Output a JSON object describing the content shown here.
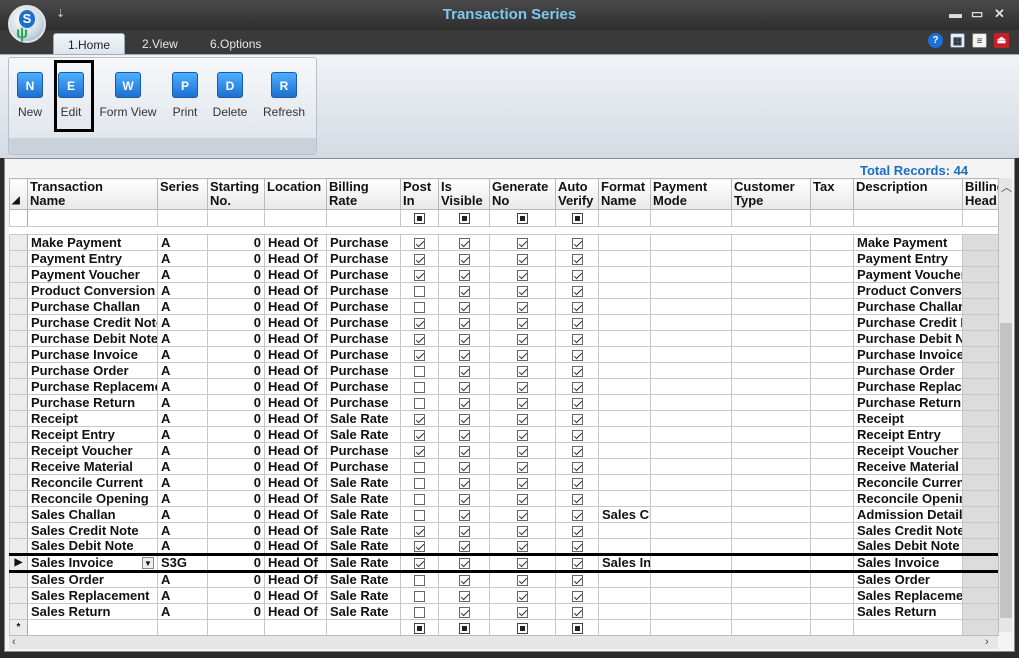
{
  "window": {
    "title": "Transaction Series",
    "qa_glyph": "⇣",
    "minimize": "▬",
    "restore": "▭",
    "close": "✕"
  },
  "tabs": [
    {
      "label": "1.Home"
    },
    {
      "label": "2.View"
    },
    {
      "label": "6.Options"
    }
  ],
  "header_icons": [
    "help-icon",
    "calculator-icon",
    "notes-icon",
    "exit-icon"
  ],
  "ribbon": {
    "buttons": [
      {
        "label": "New",
        "glyph": "N"
      },
      {
        "label": "Edit",
        "glyph": "E"
      },
      {
        "label": "Form View",
        "glyph": "W"
      },
      {
        "label": "Print",
        "glyph": "P"
      },
      {
        "label": "Delete",
        "glyph": "D"
      },
      {
        "label": "Refresh",
        "glyph": "R"
      }
    ]
  },
  "grid": {
    "total_records": "Total Records: 44",
    "columns": [
      "Transaction\nName",
      "Series",
      "Starting\nNo.",
      "Location",
      "Billing\nRate",
      "Post\nIn",
      "Is\nVisible",
      "Generate\nNo",
      "Auto\nVerify",
      "Format\nName",
      "Payment\nMode",
      "Customer\nType",
      "Tax",
      "Description",
      "Billing\nHead"
    ],
    "rows": [
      {
        "name": "Make Payment",
        "series": "A",
        "start": "0",
        "location": "Head Of",
        "rate": "Purchase",
        "post": true,
        "visible": true,
        "gen": true,
        "auto": true,
        "format": "",
        "desc": "Make Payment"
      },
      {
        "name": "Payment Entry",
        "series": "A",
        "start": "0",
        "location": "Head Of",
        "rate": "Purchase",
        "post": true,
        "visible": true,
        "gen": true,
        "auto": true,
        "format": "",
        "desc": "Payment Entry"
      },
      {
        "name": "Payment Voucher",
        "series": "A",
        "start": "0",
        "location": "Head Of",
        "rate": "Purchase",
        "post": true,
        "visible": true,
        "gen": true,
        "auto": true,
        "format": "",
        "desc": "Payment Voucher"
      },
      {
        "name": "Product Conversion",
        "series": "A",
        "start": "0",
        "location": "Head Of",
        "rate": "Purchase",
        "post": false,
        "visible": true,
        "gen": true,
        "auto": true,
        "format": "",
        "desc": "Product Conversion"
      },
      {
        "name": "Purchase Challan",
        "series": "A",
        "start": "0",
        "location": "Head Of",
        "rate": "Purchase",
        "post": false,
        "visible": true,
        "gen": true,
        "auto": true,
        "format": "",
        "desc": "Purchase Challan"
      },
      {
        "name": "Purchase Credit Note",
        "series": "A",
        "start": "0",
        "location": "Head Of",
        "rate": "Purchase",
        "post": true,
        "visible": true,
        "gen": true,
        "auto": true,
        "format": "",
        "desc": "Purchase Credit Note"
      },
      {
        "name": "Purchase Debit Note",
        "series": "A",
        "start": "0",
        "location": "Head Of",
        "rate": "Purchase",
        "post": true,
        "visible": true,
        "gen": true,
        "auto": true,
        "format": "",
        "desc": "Purchase Debit Note"
      },
      {
        "name": "Purchase Invoice",
        "series": "A",
        "start": "0",
        "location": "Head Of",
        "rate": "Purchase",
        "post": true,
        "visible": true,
        "gen": true,
        "auto": true,
        "format": "",
        "desc": "Purchase Invoice"
      },
      {
        "name": "Purchase Order",
        "series": "A",
        "start": "0",
        "location": "Head Of",
        "rate": "Purchase",
        "post": false,
        "visible": true,
        "gen": true,
        "auto": true,
        "format": "",
        "desc": "Purchase Order"
      },
      {
        "name": "Purchase Replacement",
        "series": "A",
        "start": "0",
        "location": "Head Of",
        "rate": "Purchase",
        "post": false,
        "visible": true,
        "gen": true,
        "auto": true,
        "format": "",
        "desc": "Purchase Replacement"
      },
      {
        "name": "Purchase Return",
        "series": "A",
        "start": "0",
        "location": "Head Of",
        "rate": "Purchase",
        "post": false,
        "visible": true,
        "gen": true,
        "auto": true,
        "format": "",
        "desc": "Purchase Return"
      },
      {
        "name": "Receipt",
        "series": "A",
        "start": "0",
        "location": "Head Of",
        "rate": "Sale Rate",
        "post": true,
        "visible": true,
        "gen": true,
        "auto": true,
        "format": "",
        "desc": "Receipt"
      },
      {
        "name": "Receipt Entry",
        "series": "A",
        "start": "0",
        "location": "Head Of",
        "rate": "Sale Rate",
        "post": true,
        "visible": true,
        "gen": true,
        "auto": true,
        "format": "",
        "desc": "Receipt Entry"
      },
      {
        "name": "Receipt Voucher",
        "series": "A",
        "start": "0",
        "location": "Head Of",
        "rate": "Purchase",
        "post": true,
        "visible": true,
        "gen": true,
        "auto": true,
        "format": "",
        "desc": "Receipt Voucher"
      },
      {
        "name": "Receive Material",
        "series": "A",
        "start": "0",
        "location": "Head Of",
        "rate": "Purchase",
        "post": false,
        "visible": true,
        "gen": true,
        "auto": true,
        "format": "",
        "desc": "Receive Material"
      },
      {
        "name": "Reconcile Current",
        "series": "A",
        "start": "0",
        "location": "Head Of",
        "rate": "Sale Rate",
        "post": false,
        "visible": true,
        "gen": true,
        "auto": true,
        "format": "",
        "desc": "Reconcile Current"
      },
      {
        "name": "Reconcile Opening",
        "series": "A",
        "start": "0",
        "location": "Head Of",
        "rate": "Sale Rate",
        "post": false,
        "visible": true,
        "gen": true,
        "auto": true,
        "format": "",
        "desc": "Reconcile Opening"
      },
      {
        "name": "Sales Challan",
        "series": "A",
        "start": "0",
        "location": "Head Of",
        "rate": "Sale Rate",
        "post": false,
        "visible": true,
        "gen": true,
        "auto": true,
        "format": "Sales Challan",
        "desc": "Admission Details"
      },
      {
        "name": "Sales Credit Note",
        "series": "A",
        "start": "0",
        "location": "Head Of",
        "rate": "Sale Rate",
        "post": true,
        "visible": true,
        "gen": true,
        "auto": true,
        "format": "",
        "desc": "Sales Credit Note"
      },
      {
        "name": "Sales Debit Note",
        "series": "A",
        "start": "0",
        "location": "Head Of",
        "rate": "Sale Rate",
        "post": true,
        "visible": true,
        "gen": true,
        "auto": true,
        "format": "",
        "desc": "Sales Debit Note"
      },
      {
        "name": "Sales Invoice",
        "series": "S3G",
        "start": "0",
        "location": "Head Of",
        "rate": "Sale Rate",
        "post": true,
        "visible": true,
        "gen": true,
        "auto": true,
        "format": "Sales Invoice",
        "desc": "Sales Invoice",
        "selected": true
      },
      {
        "name": "Sales Order",
        "series": "A",
        "start": "0",
        "location": "Head Of",
        "rate": "Sale Rate",
        "post": false,
        "visible": true,
        "gen": true,
        "auto": true,
        "format": "",
        "desc": "Sales Order"
      },
      {
        "name": "Sales Replacement",
        "series": "A",
        "start": "0",
        "location": "Head Of",
        "rate": "Sale Rate",
        "post": false,
        "visible": true,
        "gen": true,
        "auto": true,
        "format": "",
        "desc": "Sales Replacement"
      },
      {
        "name": "Sales Return",
        "series": "A",
        "start": "0",
        "location": "Head Of",
        "rate": "Sale Rate",
        "post": false,
        "visible": true,
        "gen": true,
        "auto": true,
        "format": "",
        "desc": "Sales Return"
      }
    ],
    "selected_indicator": "▶",
    "new_row_indicator": "*",
    "dropdown_glyph": "▼",
    "sort_glyph": "◢"
  }
}
